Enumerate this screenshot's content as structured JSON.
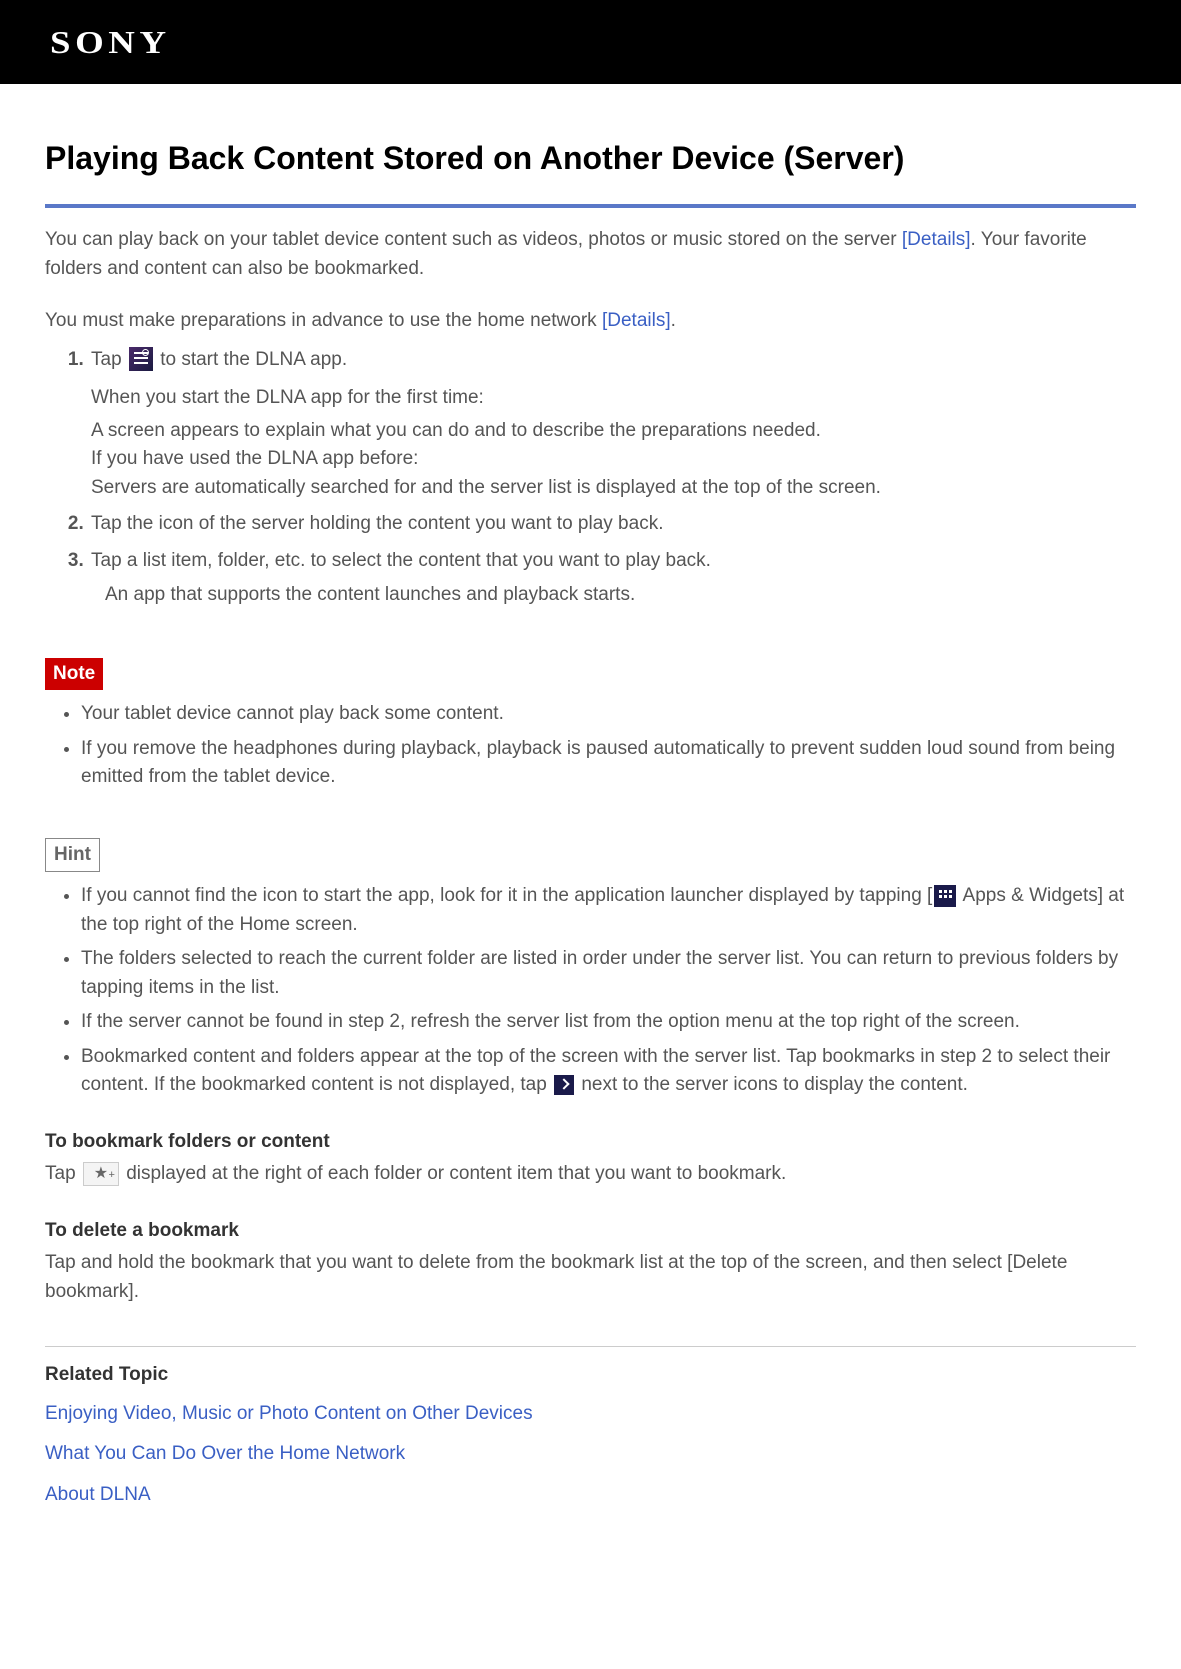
{
  "brand": "SONY",
  "title": "Playing Back Content Stored on Another Device (Server)",
  "intro1_a": "You can play back on your tablet device content such as videos, photos or music stored on the server ",
  "intro1_link": "[Details]",
  "intro1_b": ". Your favorite folders and content can also be bookmarked.",
  "intro2_a": "You must make preparations in advance to use the home network ",
  "intro2_link": "[Details]",
  "intro2_b": ".",
  "steps": {
    "s1a": "Tap ",
    "s1b": " to start the DLNA app.",
    "s1_sub1": "When you start the DLNA app for the first time:",
    "s1_sub2": "A screen appears to explain what you can do and to describe the preparations needed.",
    "s1_sub3": "If you have used the DLNA app before:",
    "s1_sub4": "Servers are automatically searched for and the server list is displayed at the top of the screen.",
    "s2": "Tap the icon of the server holding the content you want to play back.",
    "s3": "Tap a list item, folder, etc. to select the content that you want to play back.",
    "s3_bullet": "An app that supports the content launches and playback starts."
  },
  "note_label": "Note",
  "notes": [
    "Your tablet device cannot play back some content.",
    "If you remove the headphones during playback, playback is paused automatically to prevent sudden loud sound from being emitted from the tablet device."
  ],
  "hint_label": "Hint",
  "hints": {
    "h1a": "If you cannot find the icon to start the app, look for it in the application launcher displayed by tapping [",
    "h1b": " Apps & Widgets] at the top right of the Home screen.",
    "h2": "The folders selected to reach the current folder are listed in order under the server list. You can return to previous folders by tapping items in the list.",
    "h3": "If the server cannot be found in step 2, refresh the server list from the option menu at the top right of the screen.",
    "h4a": "Bookmarked content and folders appear at the top of the screen with the server list. Tap bookmarks in step 2 to select their content. If the bookmarked content is not displayed, tap ",
    "h4b": " next to the server icons to display the content."
  },
  "bookmark": {
    "head": "To bookmark folders or content",
    "text_a": "Tap ",
    "text_b": " displayed at the right of each folder or content item that you want to bookmark."
  },
  "delete_bm": {
    "head": "To delete a bookmark",
    "text": "Tap and hold the bookmark that you want to delete from the bookmark list at the top of the screen, and then select [Delete bookmark]."
  },
  "related": {
    "title": "Related Topic",
    "links": [
      "Enjoying Video, Music or Photo Content on Other Devices",
      "What You Can Do Over the Home Network",
      "About DLNA"
    ]
  }
}
